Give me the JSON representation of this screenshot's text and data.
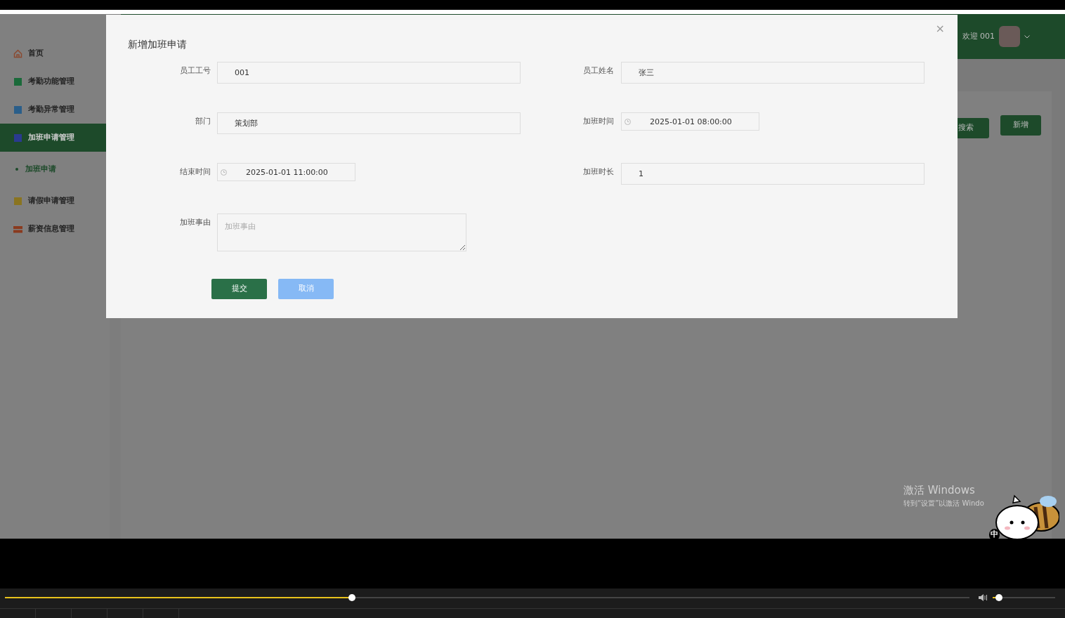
{
  "sidebar": {
    "items": [
      {
        "label": "首页",
        "selected": false,
        "color": "#8a4a30",
        "kind": "home"
      },
      {
        "label": "考勤功能管理",
        "selected": false,
        "color": "#1a6a3a",
        "kind": "square"
      },
      {
        "label": "考勤异常管理",
        "selected": false,
        "color": "#2a5e8a",
        "kind": "square"
      },
      {
        "label": "加班申请管理",
        "selected": true,
        "color": "#2a3a90",
        "kind": "square",
        "children": [
          {
            "label": "加班申请",
            "selected": true
          }
        ]
      },
      {
        "label": "请假申请管理",
        "selected": false,
        "color": "#8a7420",
        "kind": "square"
      },
      {
        "label": "薪资信息管理",
        "selected": false,
        "color": "#8a3a1e",
        "kind": "bars"
      }
    ]
  },
  "header": {
    "greeting": "欢迎 001"
  },
  "toolbar": {
    "buttons": [
      "搜索",
      "新增"
    ]
  },
  "dialog": {
    "title": "新增加班申请",
    "close": "×",
    "fields": [
      {
        "kind": "text",
        "label": "员工工号",
        "value": "001"
      },
      {
        "kind": "text",
        "label": "员工姓名",
        "value": "张三"
      },
      {
        "kind": "text",
        "label": "部门",
        "value": "策划部"
      },
      {
        "kind": "datetime",
        "label": "加班时间",
        "value": "2025-01-01 08:00:00"
      },
      {
        "kind": "datetime",
        "label": "结束时间",
        "value": "2025-01-01 11:00:00"
      },
      {
        "kind": "text",
        "label": "加班时长",
        "value": "1"
      },
      {
        "kind": "textarea",
        "label": "加班事由",
        "placeholder": "加班事由"
      }
    ],
    "buttons": [
      {
        "label": "提交",
        "kind": "primary"
      },
      {
        "label": "取消",
        "kind": "secondary"
      }
    ]
  },
  "os_notice": {
    "title": "激活 Windows",
    "subtitle": "转到“设置”以激活 Windo"
  },
  "ime": "中",
  "player": {
    "progress": {
      "level": 0.36
    },
    "volume": {
      "level": 0.1
    }
  }
}
